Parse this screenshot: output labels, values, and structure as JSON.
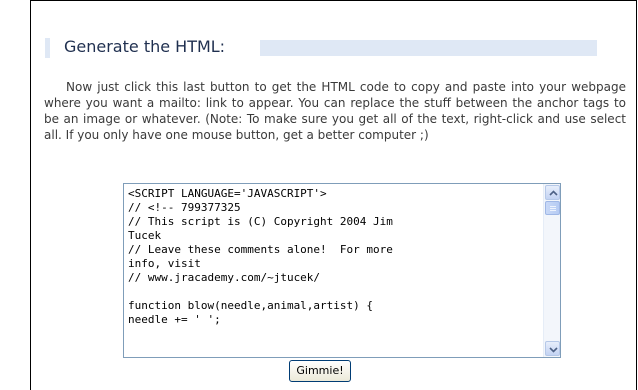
{
  "section": {
    "heading": "Generate the HTML:",
    "paragraph": "Now just click this last button to get the HTML code to copy and paste into your webpage where you want a mailto: link to appear. You can replace the stuff between the anchor tags to be an image or whatever. (Note: To make sure you get all of the text, right-click and use select all. If you only have one mouse button, get a better computer ;)"
  },
  "code_output": {
    "text": "<SCRIPT LANGUAGE='JAVASCRIPT'>\n// <!-- 799377325\n// This script is (C) Copyright 2004 Jim\nTucek\n// Leave these comments alone!  For more\ninfo, visit\n// www.jracademy.com/~jtucek/\n\nfunction blow(needle,animal,artist) {\nneedle += ' ';"
  },
  "button": {
    "label": "Gimmie!"
  },
  "colors": {
    "heading_bar": "#dfe8f5",
    "heading_text": "#1f2f4f",
    "body_text": "#3a3a3a",
    "textarea_border": "#7f9db9"
  },
  "icons": {
    "scroll_up": "chevron-up-icon",
    "scroll_down": "chevron-down-icon"
  }
}
